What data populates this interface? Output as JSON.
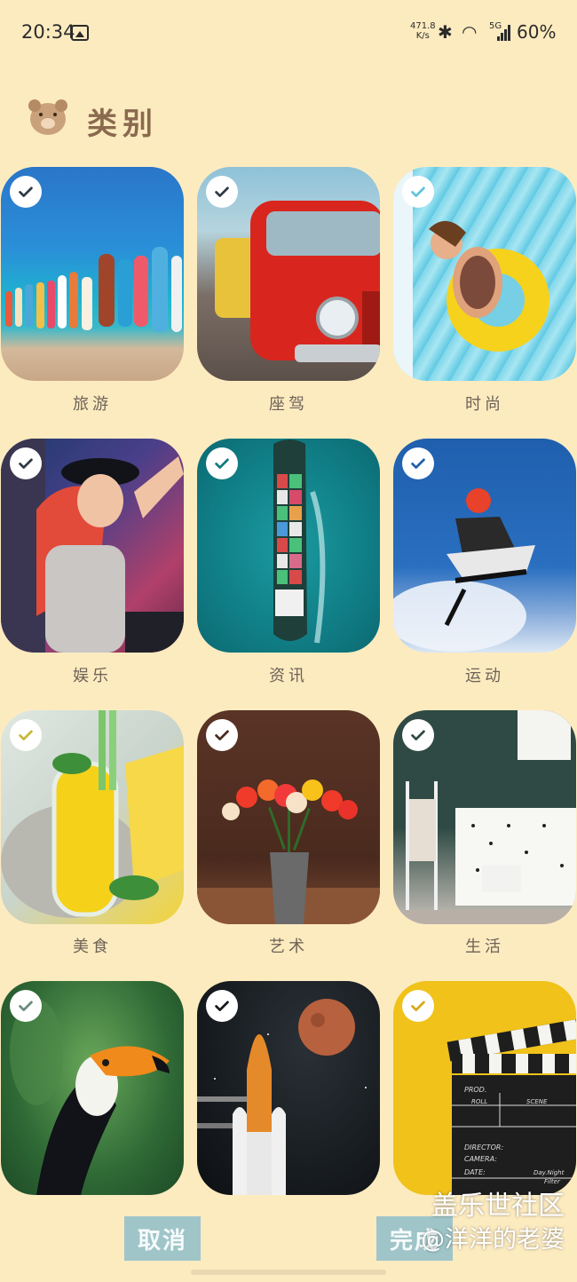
{
  "status_bar": {
    "time": "20:34",
    "net_speed_value": "471.8",
    "net_speed_unit": "K/s",
    "network_type": "5G",
    "battery": "60%"
  },
  "header": {
    "title": "类别",
    "icon": "bear-icon"
  },
  "categories": [
    {
      "label": "旅游",
      "checked": true,
      "image": "colorful boats on beach"
    },
    {
      "label": "座驾",
      "checked": true,
      "image": "red vintage car"
    },
    {
      "label": "时尚",
      "checked": true,
      "image": "woman on float in pool"
    },
    {
      "label": "娱乐",
      "checked": true,
      "image": "DJ with headphones"
    },
    {
      "label": "资讯",
      "checked": true,
      "image": "container ship aerial"
    },
    {
      "label": "运动",
      "checked": true,
      "image": "snowmobile jump"
    },
    {
      "label": "美食",
      "checked": true,
      "image": "lemonade with lemons"
    },
    {
      "label": "艺术",
      "checked": true,
      "image": "tulips in vase"
    },
    {
      "label": "生活",
      "checked": true,
      "image": "room interior"
    },
    {
      "label": "",
      "checked": true,
      "image": "toucan"
    },
    {
      "label": "",
      "checked": true,
      "image": "space shuttle and mars"
    },
    {
      "label": "",
      "checked": true,
      "image": "film clapperboard"
    }
  ],
  "clapper_text": {
    "prod": "PROD.",
    "roll": "ROLL",
    "scene": "SCENE",
    "director": "DIRECTOR:",
    "camera": "CAMERA:",
    "date": "DATE:",
    "day_night": "Day.Night",
    "filter": "Filter"
  },
  "buttons": {
    "cancel": "取消",
    "done": "完成"
  },
  "watermark": {
    "line1": "盖乐世社区",
    "line2": "@洋洋的老婆"
  },
  "colors": {
    "background": "#fdebc0",
    "button": "#9fc5c9",
    "title": "#8a6a4f"
  }
}
